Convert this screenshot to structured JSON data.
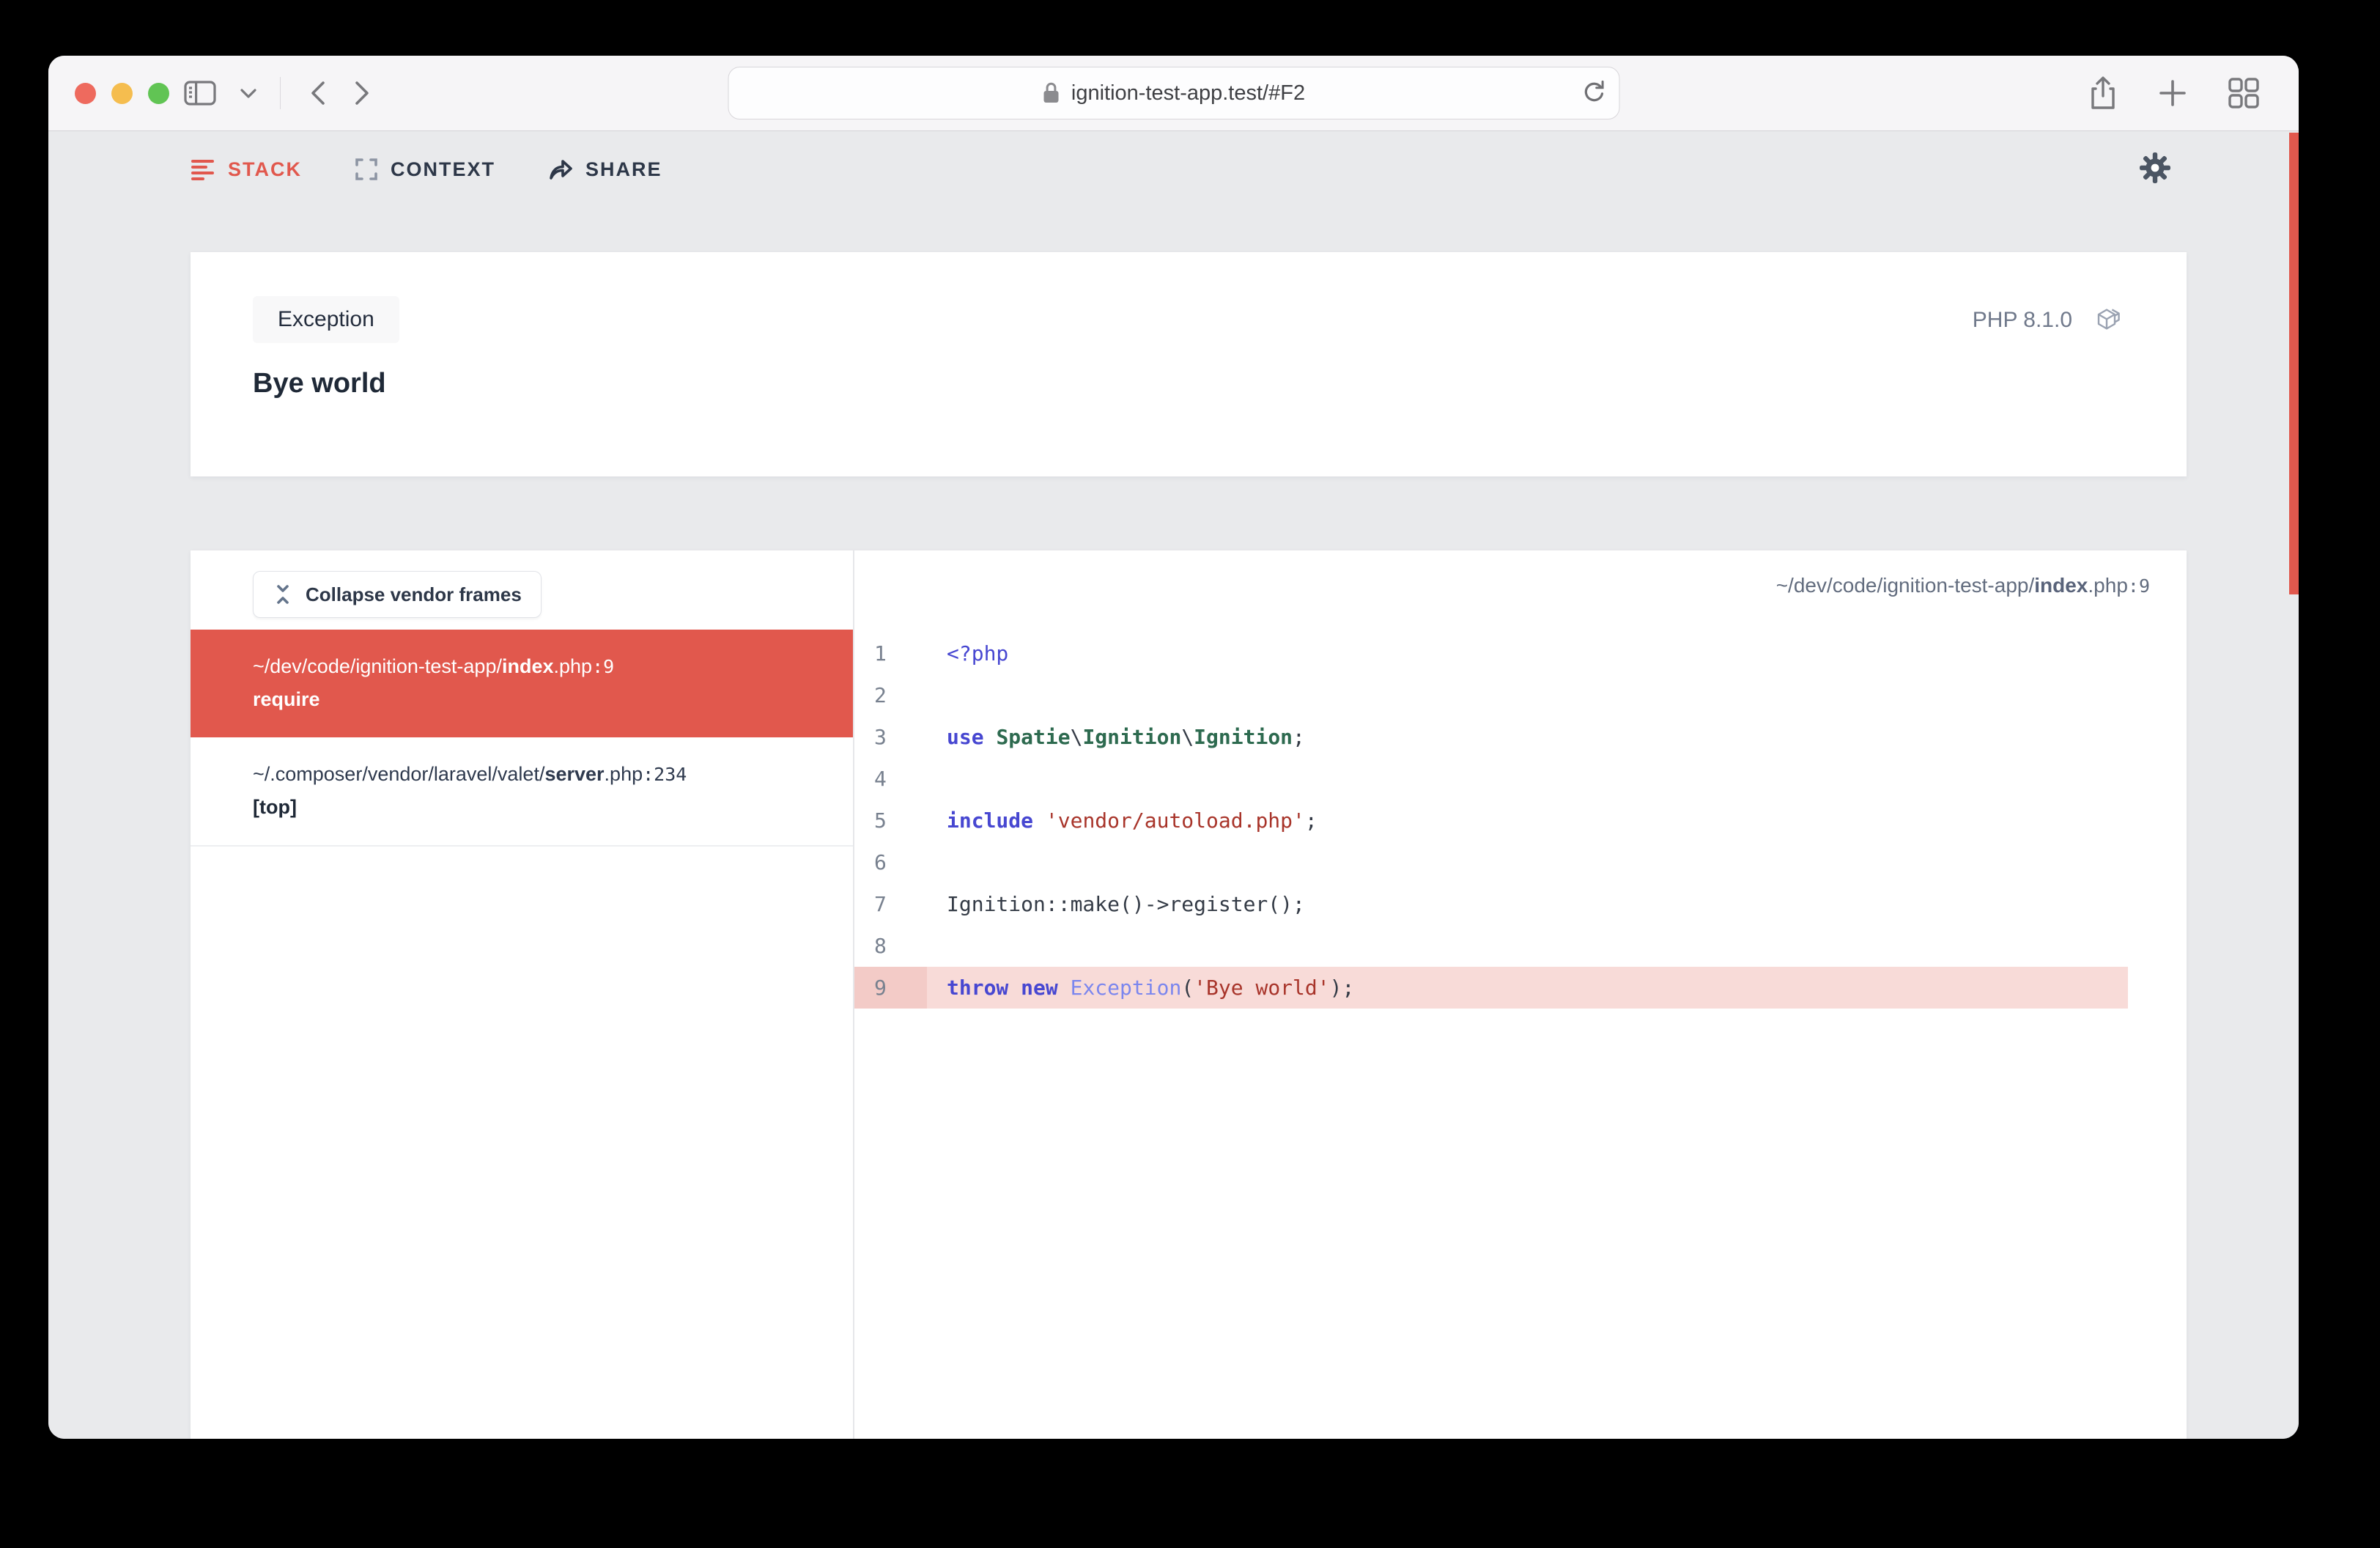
{
  "browser": {
    "url": "ignition-test-app.test/#F2",
    "window_controls": [
      "close",
      "minimize",
      "zoom"
    ]
  },
  "nav": {
    "items": [
      {
        "label": "STACK",
        "icon": "stack-lines-icon",
        "active": true
      },
      {
        "label": "CONTEXT",
        "icon": "context-brackets-icon",
        "active": false
      },
      {
        "label": "SHARE",
        "icon": "share-arrow-icon",
        "active": false
      }
    ]
  },
  "exception": {
    "badge": "Exception",
    "message": "Bye world",
    "php_version": "PHP 8.1.0"
  },
  "stack": {
    "collapse_label": "Collapse vendor frames",
    "frames": [
      {
        "prefix": "~/dev/code/ignition-test-app/",
        "file": "index",
        "suffix": ".php",
        "line_label": ":9",
        "method": "require",
        "active": true
      },
      {
        "prefix": "~/.composer/vendor/laravel/valet/",
        "file": "server",
        "suffix": ".php",
        "line_label": ":234",
        "method": "[top]",
        "active": false
      }
    ]
  },
  "code": {
    "file_header": {
      "prefix": "~/dev/code/ignition-test-app/",
      "file": "index",
      "suffix": ".php",
      "line_label": ":9"
    },
    "lines": [
      {
        "n": "1",
        "tokens": [
          {
            "text": "<?php",
            "cls": "tag"
          }
        ]
      },
      {
        "n": "2",
        "tokens": []
      },
      {
        "n": "3",
        "tokens": [
          {
            "text": "use",
            "cls": "kw"
          },
          {
            "text": " ",
            "cls": "pln"
          },
          {
            "text": "Spatie",
            "cls": "cls"
          },
          {
            "text": "\\",
            "cls": "pln"
          },
          {
            "text": "Ignition",
            "cls": "cls"
          },
          {
            "text": "\\",
            "cls": "pln"
          },
          {
            "text": "Ignition",
            "cls": "cls"
          },
          {
            "text": ";",
            "cls": "pln"
          }
        ]
      },
      {
        "n": "4",
        "tokens": []
      },
      {
        "n": "5",
        "tokens": [
          {
            "text": "include",
            "cls": "kw"
          },
          {
            "text": " ",
            "cls": "pln"
          },
          {
            "text": "'vendor/autoload.php'",
            "cls": "str"
          },
          {
            "text": ";",
            "cls": "pln"
          }
        ]
      },
      {
        "n": "6",
        "tokens": []
      },
      {
        "n": "7",
        "tokens": [
          {
            "text": "Ignition::make()->register();",
            "cls": "pln"
          }
        ]
      },
      {
        "n": "8",
        "tokens": []
      },
      {
        "n": "9",
        "highlight": true,
        "tokens": [
          {
            "text": "throw",
            "cls": "kw"
          },
          {
            "text": " ",
            "cls": "pln"
          },
          {
            "text": "new",
            "cls": "kw"
          },
          {
            "text": " ",
            "cls": "pln"
          },
          {
            "text": "Exception",
            "cls": "exc"
          },
          {
            "text": "(",
            "cls": "pln"
          },
          {
            "text": "'Bye world'",
            "cls": "str"
          },
          {
            "text": ");",
            "cls": "pln"
          }
        ]
      }
    ]
  },
  "icons": [
    "sidebar-toggle-icon",
    "chevron-down-icon",
    "back-icon",
    "forward-icon",
    "lock-icon",
    "reload-icon",
    "share-upload-icon",
    "new-tab-icon",
    "tab-overview-icon",
    "stack-lines-icon",
    "context-brackets-icon",
    "share-arrow-icon",
    "gear-icon",
    "collapse-vertical-icon",
    "laravel-logo-icon"
  ],
  "colors": {
    "accent_red": "#e1584d",
    "page_bg": "#e9eaec",
    "card_bg": "#ffffff",
    "code_keyword": "#4747d1",
    "code_class": "#2d6a4f",
    "code_string": "#a8342a",
    "code_exception": "#7b86ee",
    "code_plain": "#343b46",
    "highlight_row": "#f8dbd8",
    "highlight_gutter": "#f3cbc7",
    "traffic_red": "#ee6a5e",
    "traffic_yellow": "#f5bd4f",
    "traffic_green": "#61c454"
  }
}
